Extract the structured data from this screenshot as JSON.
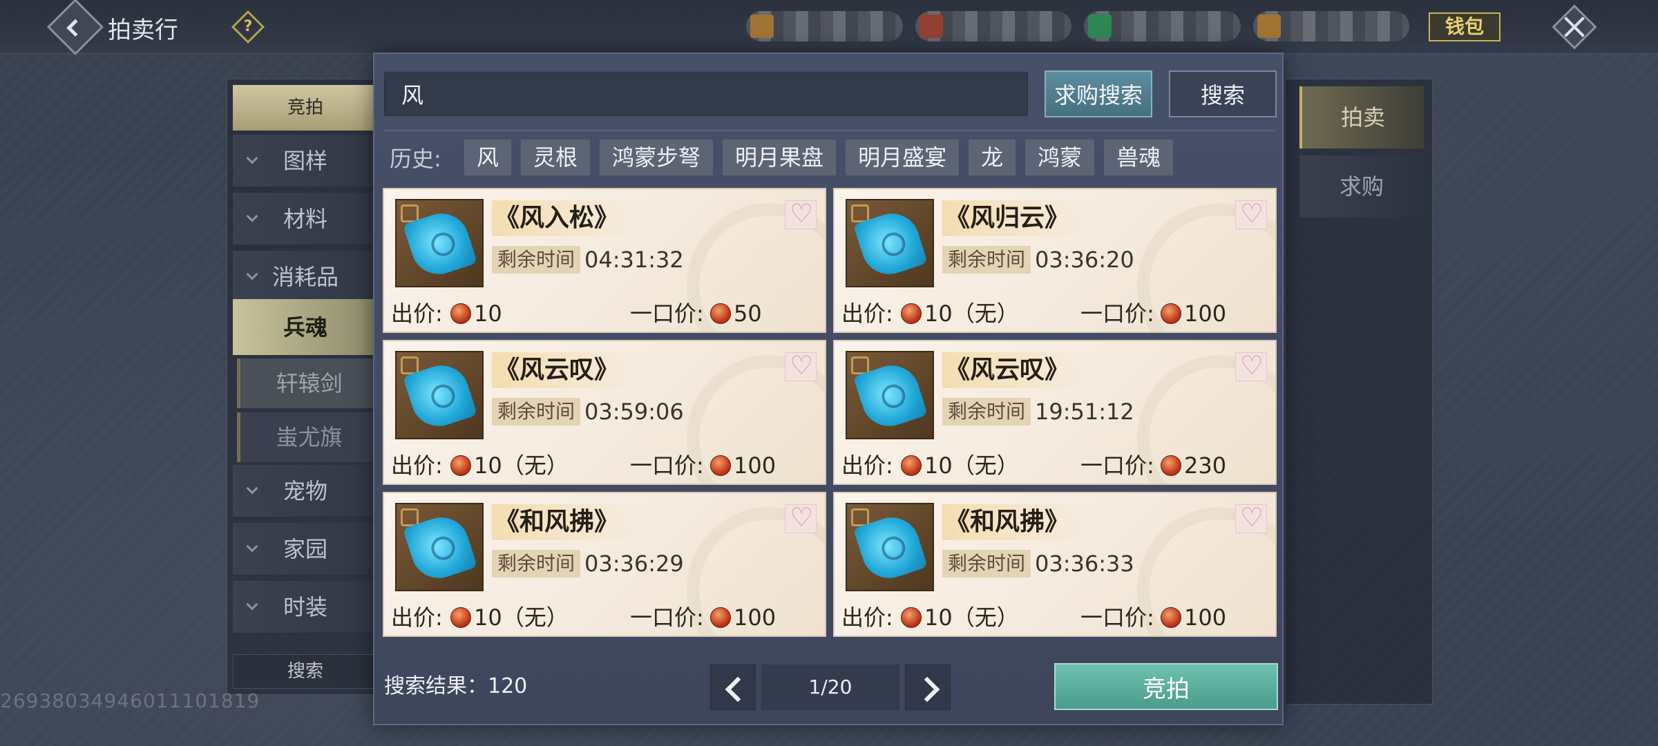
{
  "header": {
    "title": "拍卖行",
    "help_label": "?",
    "wallet_label": "钱包"
  },
  "colors": {
    "accent_teal": "#4b9b8a",
    "card_bg": "#f4e9dc",
    "panel_bg": "#434b62"
  },
  "left_nav": {
    "top_label": "竞拍",
    "categories": [
      {
        "label": "图样"
      },
      {
        "label": "材料"
      },
      {
        "label": "消耗品"
      },
      {
        "label": "兵魂"
      },
      {
        "label": "轩辕剑"
      },
      {
        "label": "蚩尤旗"
      },
      {
        "label": "宠物"
      },
      {
        "label": "家园"
      },
      {
        "label": "时装"
      }
    ],
    "search_label": "搜索"
  },
  "right_tabs": [
    {
      "label": "拍卖"
    },
    {
      "label": "求购"
    }
  ],
  "search": {
    "value": "风",
    "buy_search_label": "求购搜索",
    "search_label": "搜索"
  },
  "history": {
    "label": "历史:",
    "tags": [
      "风",
      "灵根",
      "鸿蒙步弩",
      "明月果盘",
      "明月盛宴",
      "龙",
      "鸿蒙",
      "兽魂"
    ]
  },
  "card_labels": {
    "time_label": "剩余时间",
    "bid_label": "出价:",
    "buyout_label": "一口价:"
  },
  "items": [
    {
      "name": "《风入松》",
      "time": "04:31:32",
      "bid": "10",
      "buyout": "50"
    },
    {
      "name": "《风归云》",
      "time": "03:36:20",
      "bid": "10（无）",
      "buyout": "100"
    },
    {
      "name": "《风云叹》",
      "time": "03:59:06",
      "bid": "10（无）",
      "buyout": "100"
    },
    {
      "name": "《风云叹》",
      "time": "19:51:12",
      "bid": "10（无）",
      "buyout": "230"
    },
    {
      "name": "《和风拂》",
      "time": "03:36:29",
      "bid": "10（无）",
      "buyout": "100"
    },
    {
      "name": "《和风拂》",
      "time": "03:36:33",
      "bid": "10（无）",
      "buyout": "100"
    }
  ],
  "footer": {
    "result_text": "搜索结果：120",
    "page": "1/20",
    "bid_button": "竞拍"
  },
  "uid": "2693803494601110181​9"
}
